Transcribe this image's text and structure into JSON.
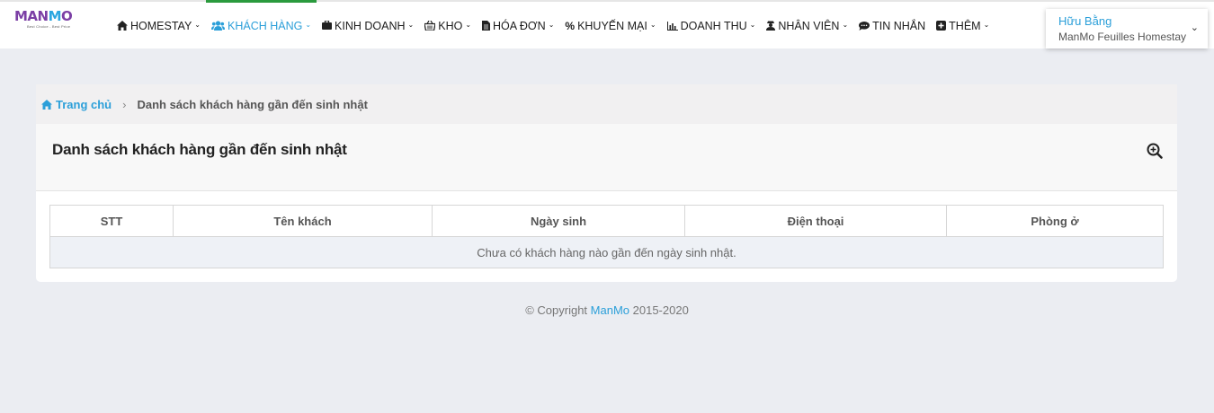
{
  "logo": {
    "text_main": "MANMO",
    "tagline": "Best Choice - Best Price"
  },
  "nav": [
    {
      "label": "HOMESTAY",
      "icon": "home-icon",
      "dropdown": true
    },
    {
      "label": "KHÁCH HÀNG",
      "icon": "users-icon",
      "dropdown": true,
      "active": true
    },
    {
      "label": "KINH DOANH",
      "icon": "briefcase-icon",
      "dropdown": true
    },
    {
      "label": "KHO",
      "icon": "basket-icon",
      "dropdown": true
    },
    {
      "label": "HÓA ĐƠN",
      "icon": "file-icon",
      "dropdown": true
    },
    {
      "label": "KHUYẾN MẠI",
      "icon": "percent-icon",
      "dropdown": true
    },
    {
      "label": "DOANH THU",
      "icon": "bar-chart-icon",
      "dropdown": true
    },
    {
      "label": "NHÂN VIÊN",
      "icon": "user-secret-icon",
      "dropdown": true
    },
    {
      "label": "TIN NHẮN",
      "icon": "comment-icon",
      "dropdown": false
    },
    {
      "label": "THÊM",
      "icon": "plus-square-icon",
      "dropdown": true
    }
  ],
  "user": {
    "name": "Hữu Bằng",
    "homestay": "ManMo Feuilles Homestay"
  },
  "breadcrumb": {
    "home": "Trang chủ",
    "separator": "›",
    "current": "Danh sách khách hàng gần đến sinh nhật"
  },
  "card": {
    "title": "Danh sách khách hàng gần đến sinh nhật"
  },
  "table": {
    "columns": [
      "STT",
      "Tên khách",
      "Ngày sinh",
      "Điện thoại",
      "Phòng ở"
    ],
    "empty_message": "Chưa có khách hàng nào gần đến ngày sinh nhật."
  },
  "footer": {
    "prefix": "© Copyright ",
    "brand": "ManMo",
    "suffix": " 2015-2020"
  },
  "colors": {
    "accent": "#2b9fd9",
    "active_tab_border": "#2a9a3d",
    "logo_purple": "#7b3fa5",
    "page_bg": "#ebedf2"
  }
}
